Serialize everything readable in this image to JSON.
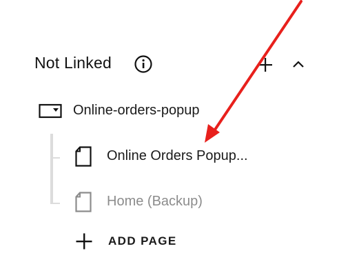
{
  "section": {
    "title": "Not Linked",
    "info_icon": "info-icon",
    "add_icon": "plus-icon",
    "collapse_icon": "chevron-up-icon"
  },
  "folder": {
    "label": "Online-orders-popup",
    "icon": "folder-dropdown-icon"
  },
  "pages": [
    {
      "label": "Online Orders Popup...",
      "icon": "page-icon",
      "state": "active"
    },
    {
      "label": "Home (Backup)",
      "icon": "page-icon",
      "state": "disabled"
    }
  ],
  "add_page": {
    "label": "ADD PAGE",
    "icon": "plus-icon"
  },
  "annotation": {
    "icon": "red-arrow-annotation",
    "color": "#e8201c"
  },
  "colors": {
    "text": "#1a1a1a",
    "muted": "#8c8c8c",
    "tree_line": "#dcdcdc"
  }
}
